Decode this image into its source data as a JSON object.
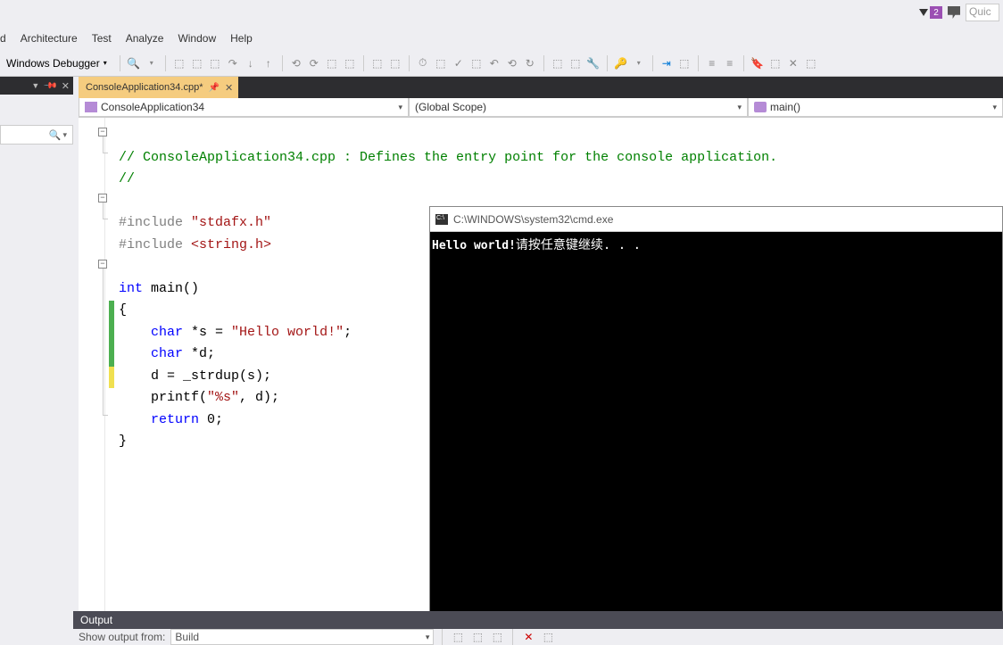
{
  "quicklaunch": {
    "placeholder": "Quic",
    "notifications": "2"
  },
  "menubar": {
    "item0": "d",
    "architecture": "Architecture",
    "test": "Test",
    "analyze": "Analyze",
    "window": "Window",
    "help": "Help"
  },
  "toolbar": {
    "debug_target": "Windows Debugger"
  },
  "tab": {
    "filename": "ConsoleApplication34.cpp*"
  },
  "nav": {
    "project": "ConsoleApplication34",
    "scope": "(Global Scope)",
    "func": "main()"
  },
  "code": {
    "c1": "// ConsoleApplication34.cpp : Defines the entry point for the console application.",
    "c2": "//",
    "inc": "#include ",
    "stdafx": "\"stdafx.h\"",
    "stringh": "<string.h>",
    "kw_int": "int",
    "main_sig": " main()",
    "ob": "{",
    "kw_char": "char",
    "s_decl": " *s = ",
    "s_lit": "\"Hello world!\"",
    "semi": ";",
    "d_decl": " *d;",
    "d_assign": "    d = _strdup(s);",
    "printf_call": "    printf(",
    "fmt": "\"%s\"",
    "printf_tail": ", d);",
    "kw_return": "return",
    "ret_tail": " 0;",
    "cb": "}"
  },
  "console": {
    "title_path": "C:\\WINDOWS\\system32\\cmd.exe",
    "hello": "Hello world!",
    "pause": "请按任意键继续. . ."
  },
  "output": {
    "title": "Output",
    "show_from_label": "Show output from:",
    "show_from_value": "Build"
  }
}
